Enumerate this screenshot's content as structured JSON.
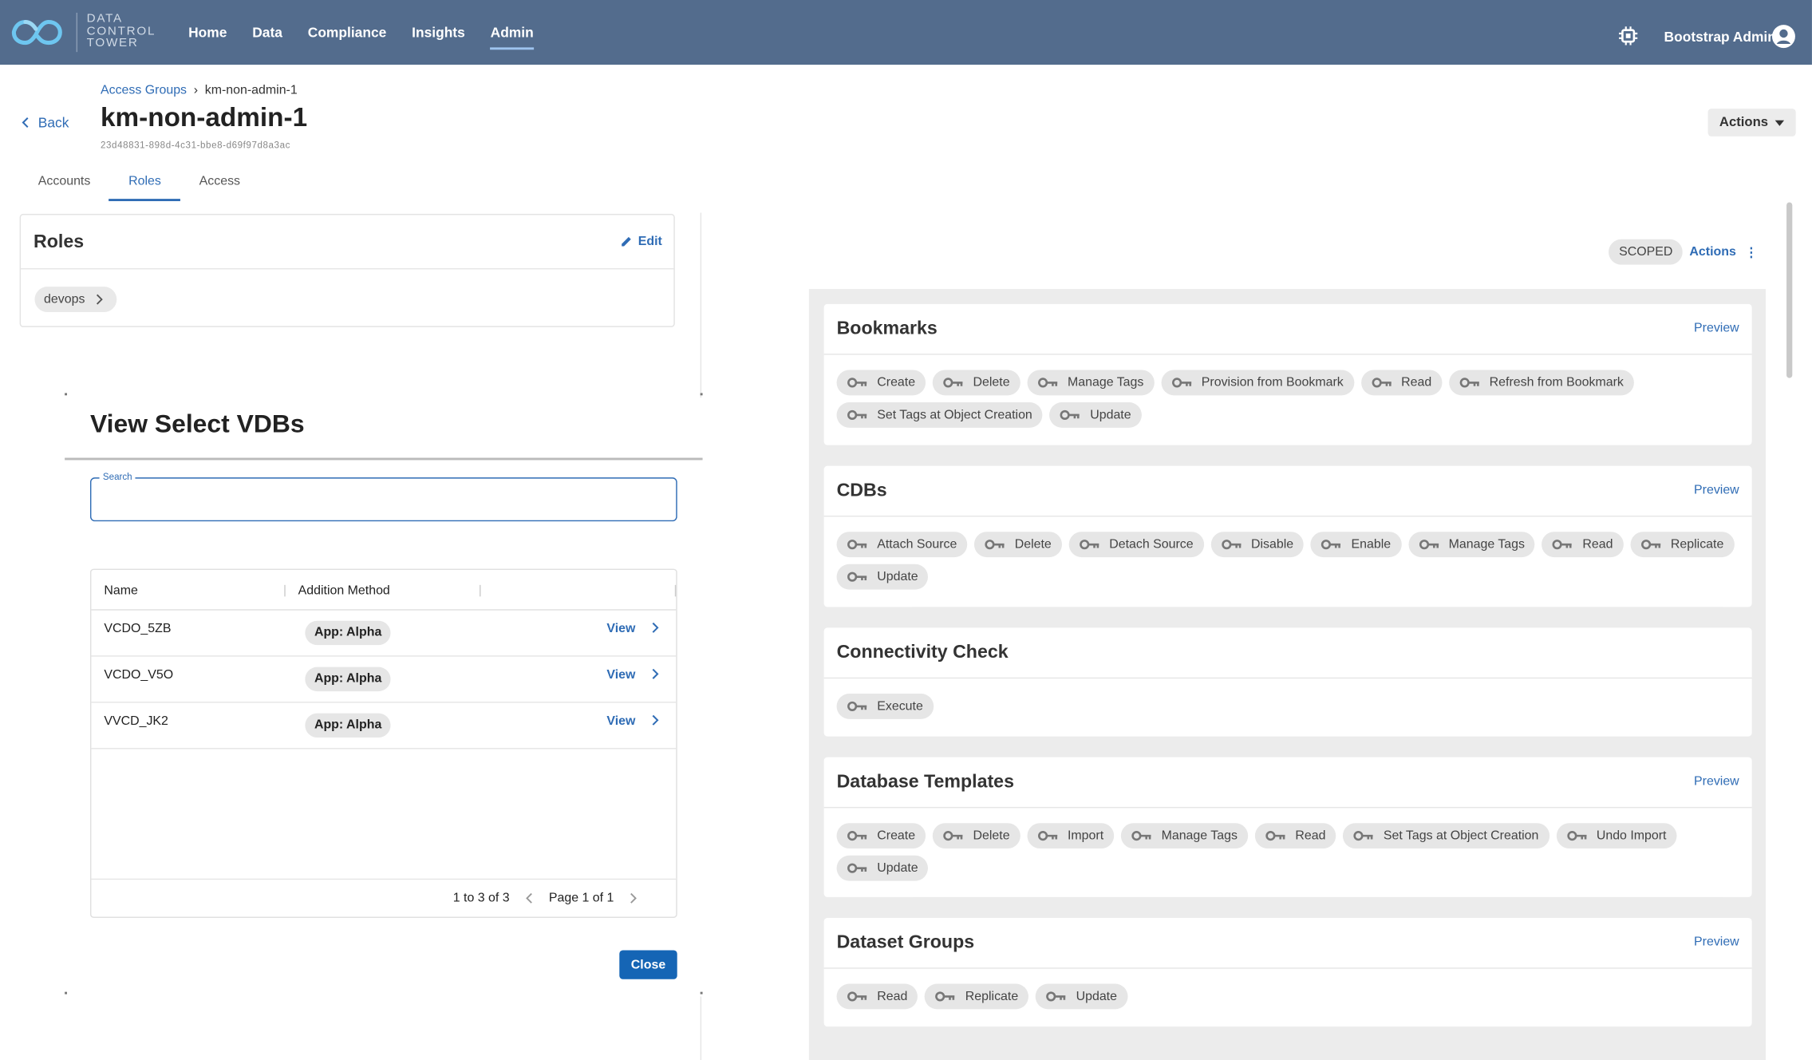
{
  "app": {
    "brand_line1": "DATA",
    "brand_line2": "CONTROL",
    "brand_line3": "TOWER",
    "user": "Bootstrap Admin"
  },
  "nav": [
    "Home",
    "Data",
    "Compliance",
    "Insights",
    "Admin"
  ],
  "colors": {
    "nav": "#536c8d",
    "accent": "#2f6cb5",
    "primary_button": "#1565b5"
  },
  "breadcrumb": {
    "parent": "Access Groups",
    "current": "km-non-admin-1"
  },
  "page": {
    "back": "Back",
    "title": "km-non-admin-1",
    "uuid": "23d48831-898d-4c31-bbe8-d69f97d8a3ac",
    "actions": "Actions"
  },
  "tabs": [
    "Accounts",
    "Roles",
    "Access"
  ],
  "roles": {
    "title": "Roles",
    "edit": "Edit",
    "items": [
      "devops"
    ]
  },
  "modal": {
    "title": "View Select VDBs",
    "search_label": "Search",
    "columns": [
      "Name",
      "Addition Method"
    ],
    "rows": [
      {
        "name": "VCDO_5ZB",
        "method": "App: Alpha",
        "action": "View"
      },
      {
        "name": "VCDO_V5O",
        "method": "App: Alpha",
        "action": "View"
      },
      {
        "name": "VVCD_JK2",
        "method": "App: Alpha",
        "action": "View"
      }
    ],
    "range": "1 to 3 of 3",
    "page": "Page 1 of 1",
    "close": "Close"
  },
  "right": {
    "badge": "SCOPED",
    "actions": "Actions",
    "kebab": "⋮",
    "preview": "Preview"
  },
  "permission_groups": [
    {
      "title": "Bookmarks",
      "perms": [
        "Create",
        "Delete",
        "Manage Tags",
        "Provision from Bookmark",
        "Read",
        "Refresh from Bookmark",
        "Set Tags at Object Creation",
        "Update"
      ]
    },
    {
      "title": "CDBs",
      "perms": [
        "Attach Source",
        "Delete",
        "Detach Source",
        "Disable",
        "Enable",
        "Manage Tags",
        "Read",
        "Replicate",
        "Update"
      ]
    },
    {
      "title": "Connectivity Check",
      "perms": [
        "Execute"
      ]
    },
    {
      "title": "Database Templates",
      "perms": [
        "Create",
        "Delete",
        "Import",
        "Manage Tags",
        "Read",
        "Set Tags at Object Creation",
        "Undo Import",
        "Update"
      ]
    },
    {
      "title": "Dataset Groups",
      "perms": [
        "Read",
        "Replicate",
        "Update"
      ]
    }
  ],
  "icons": {
    "logo": "infinity-logo",
    "chip": "chip-icon",
    "avatar": "user-avatar-icon",
    "key": "key-icon",
    "pencil": "pencil-icon"
  }
}
